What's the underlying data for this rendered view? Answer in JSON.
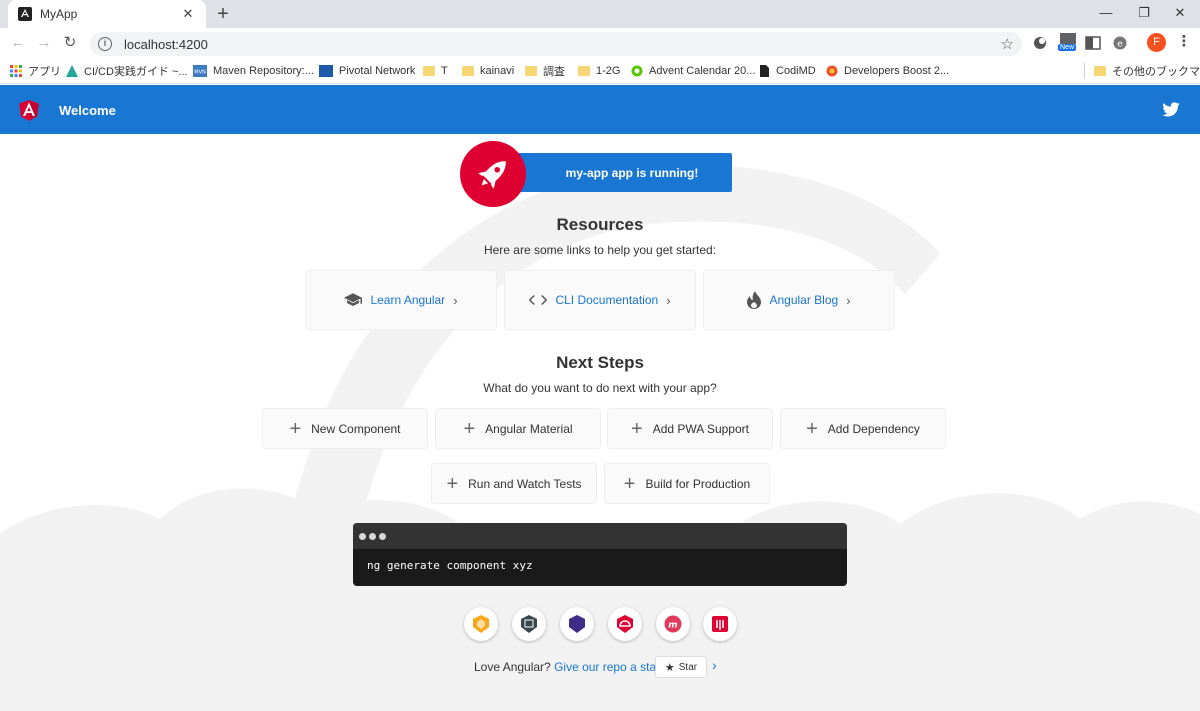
{
  "browser": {
    "tab_title": "MyApp",
    "new_tab": "+",
    "url": "localhost:4200",
    "ext_new_badge": "New",
    "profile_initial": "F",
    "bookmarks": [
      {
        "label": "アプリ"
      },
      {
        "label": "CI/CD実践ガイド ~..."
      },
      {
        "label": "Maven Repository:..."
      },
      {
        "label": "Pivotal Network"
      },
      {
        "label": "T"
      },
      {
        "label": "kainavi"
      },
      {
        "label": "調査"
      },
      {
        "label": "1-2G"
      },
      {
        "label": "Advent Calendar 20..."
      },
      {
        "label": "CodiMD"
      },
      {
        "label": "Developers Boost 2..."
      }
    ],
    "other_bookmarks": "その他のブックマーク"
  },
  "app": {
    "toolbar_title": "Welcome",
    "running_text": "my-app app is running!",
    "resources": {
      "title": "Resources",
      "subtitle": "Here are some links to help you get started:",
      "cards": [
        {
          "label": "Learn Angular"
        },
        {
          "label": "CLI Documentation"
        },
        {
          "label": "Angular Blog"
        }
      ]
    },
    "next_steps": {
      "title": "Next Steps",
      "subtitle": "What do you want to do next with your app?",
      "cards": [
        {
          "label": "New Component"
        },
        {
          "label": "Angular Material"
        },
        {
          "label": "Add PWA Support"
        },
        {
          "label": "Add Dependency"
        },
        {
          "label": "Run and Watch Tests"
        },
        {
          "label": "Build for Production"
        }
      ]
    },
    "terminal_command": "ng generate component xyz",
    "footer": {
      "text": "Love Angular?",
      "link": "Give our repo a star.",
      "star_label": "Star"
    }
  },
  "colors": {
    "primary": "#1976d2",
    "angular_red": "#dd0031"
  }
}
